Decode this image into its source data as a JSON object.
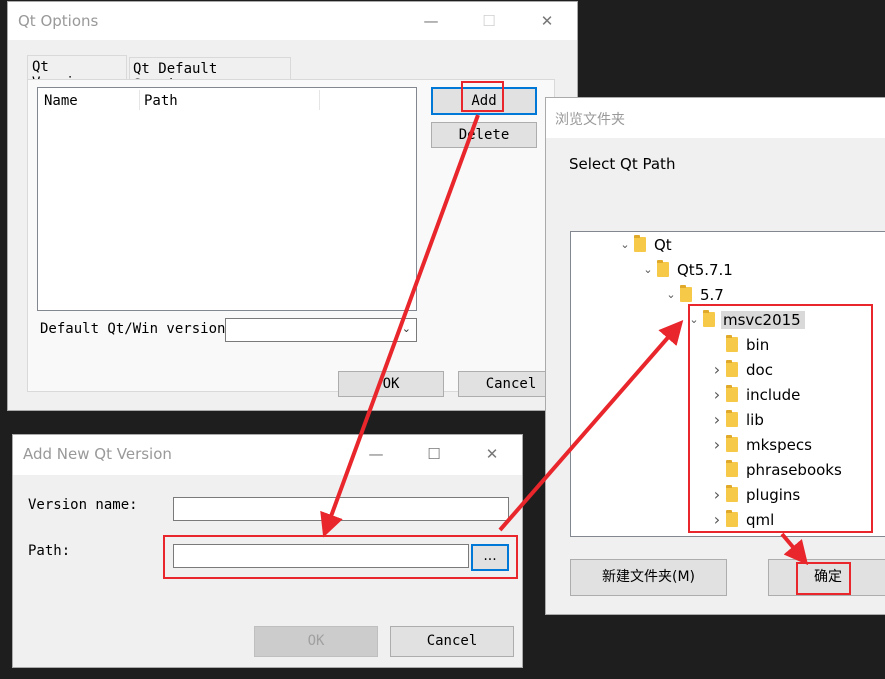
{
  "qt_options": {
    "title": "Qt Options",
    "tabs": [
      "Qt Versions",
      "Qt Default Settings"
    ],
    "columns": [
      "Name",
      "Path"
    ],
    "add_label": "Add",
    "delete_label": "Delete",
    "default_version_label": "Default Qt/Win version:",
    "ok_label": "OK",
    "cancel_label": "Cancel"
  },
  "add_version": {
    "title": "Add New Qt Version",
    "version_name_label": "Version name:",
    "version_name_value": "",
    "path_label": "Path:",
    "path_value": "",
    "browse_label": "...",
    "ok_label": "OK",
    "cancel_label": "Cancel"
  },
  "browse": {
    "title": "浏览文件夹",
    "prompt": "Select Qt Path",
    "tree": [
      {
        "label": "Qt",
        "chevron": "down"
      },
      {
        "label": "Qt5.7.1",
        "chevron": "down"
      },
      {
        "label": "5.7",
        "chevron": "down"
      },
      {
        "label": "msvc2015",
        "chevron": "down",
        "selected": true
      },
      {
        "label": "bin",
        "chevron": "none"
      },
      {
        "label": "doc",
        "chevron": "right"
      },
      {
        "label": "include",
        "chevron": "right"
      },
      {
        "label": "lib",
        "chevron": "right"
      },
      {
        "label": "mkspecs",
        "chevron": "right"
      },
      {
        "label": "phrasebooks",
        "chevron": "none"
      },
      {
        "label": "plugins",
        "chevron": "right"
      },
      {
        "label": "qml",
        "chevron": "right"
      }
    ],
    "new_folder_label": "新建文件夹(M)",
    "ok_label": "确定"
  },
  "window_controls": {
    "minimize": "—",
    "maximize": "☐",
    "close": "✕"
  },
  "colors": {
    "annotation": "#e8262b",
    "accent": "#0078d7",
    "folder": "#f7c948"
  }
}
